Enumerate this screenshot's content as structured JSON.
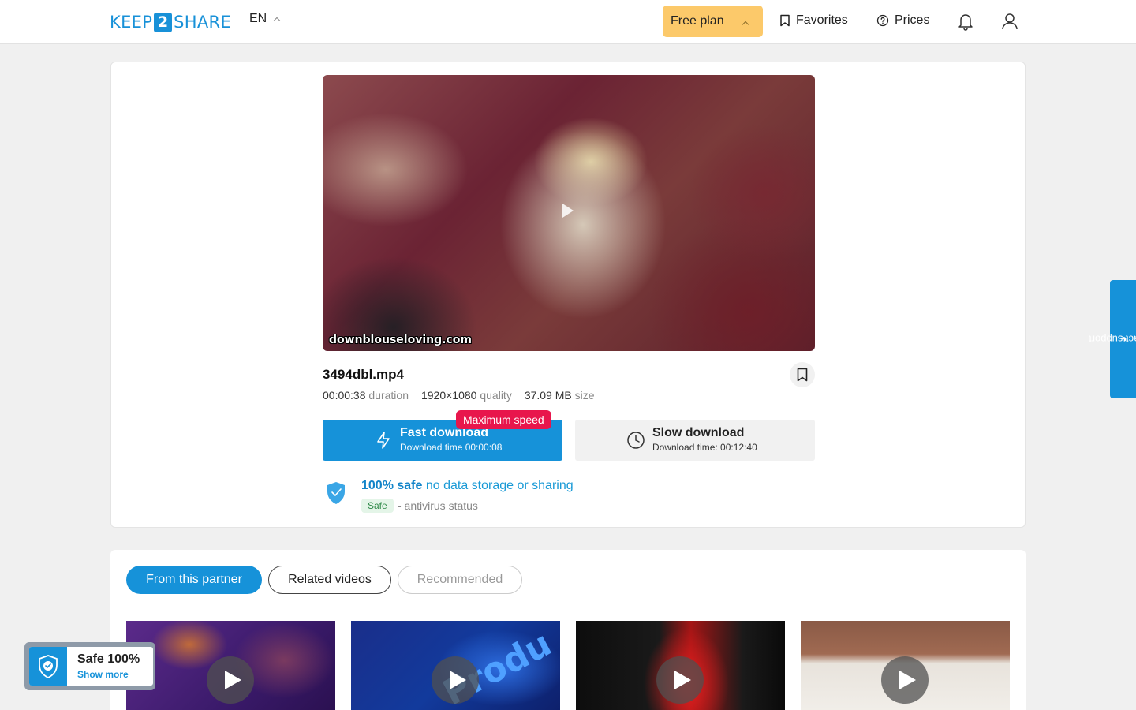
{
  "header": {
    "logo": {
      "left": "KEEP",
      "mid": "2",
      "right": "SHARE"
    },
    "language": "EN",
    "plan_label": "Free plan",
    "favorites_label": "Favorites",
    "prices_label": "Prices"
  },
  "video": {
    "watermark": "downblouseloving.com",
    "filename": "3494dbl.mp4",
    "duration_value": "00:00:38",
    "duration_label": "duration",
    "quality_value": "1920×1080",
    "quality_label": "quality",
    "size_value": "37.09 MB",
    "size_label": "size"
  },
  "download": {
    "fast_label": "Fast download",
    "fast_time": "Download time 00:00:08",
    "badge": "Maximum speed",
    "slow_label": "Slow download",
    "slow_time": "Download time: 00:12:40"
  },
  "safety": {
    "headline_bold": "100% safe",
    "headline_rest": "no data storage or sharing",
    "badge": "Safe",
    "status_text": "- antivirus status"
  },
  "support_label": "contact support",
  "tabs": [
    "From this partner",
    "Related videos",
    "Recommended"
  ],
  "thumbnails": {
    "thumb2_text": "Produ"
  },
  "safe_widget": {
    "title": "Safe 100%",
    "link": "Show more"
  },
  "colors": {
    "accent": "#1692d9",
    "plan": "#fcc96a",
    "badge_red": "#e8164c"
  }
}
